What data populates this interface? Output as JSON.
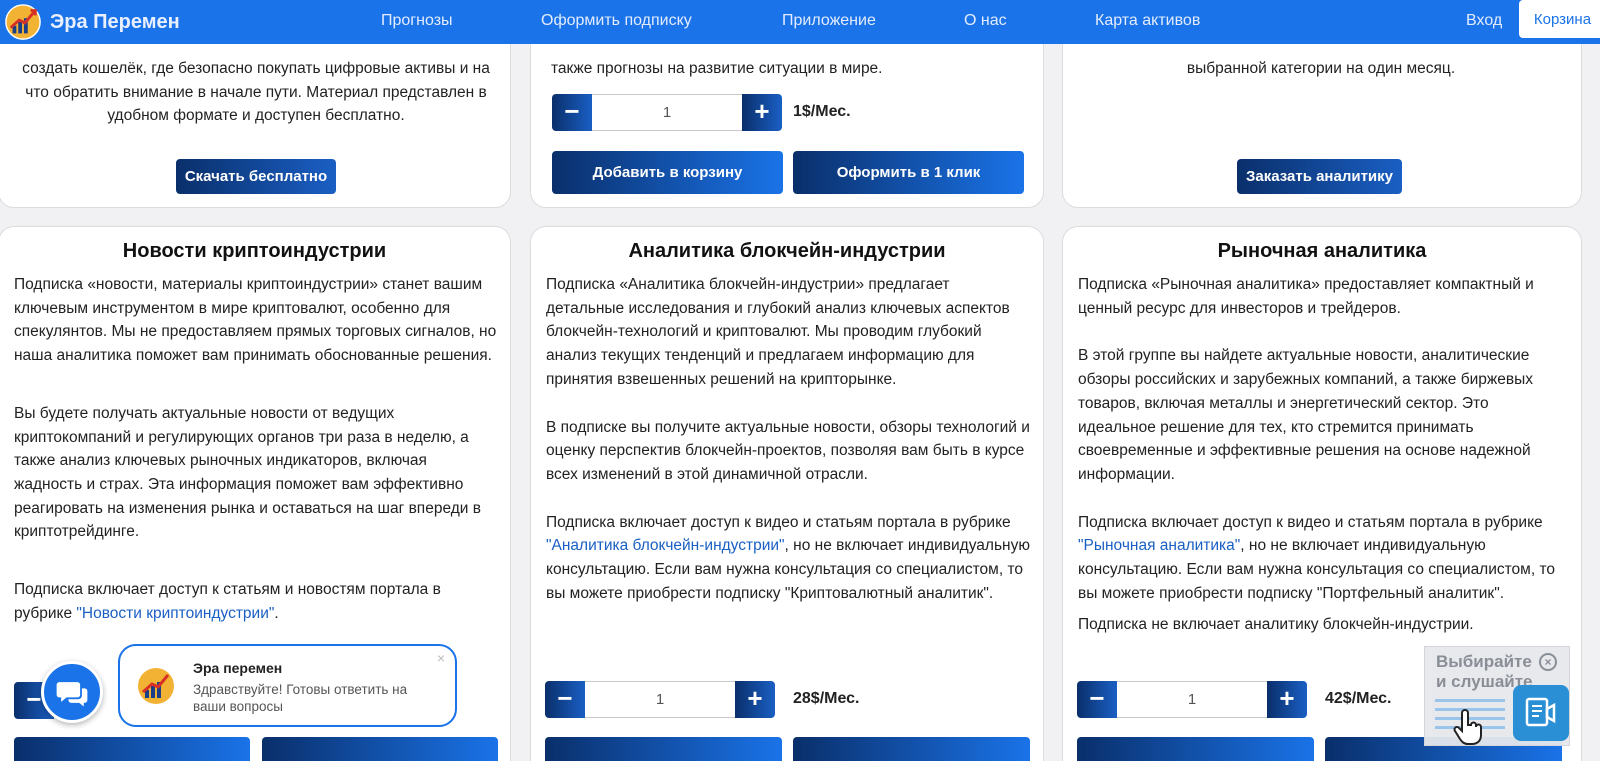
{
  "header": {
    "logo_text": "Эра Перемен",
    "nav": [
      "Прогнозы",
      "Оформить подписку",
      "Приложение",
      "О нас",
      "Карта активов"
    ],
    "login": "Вход",
    "cart": "Корзина"
  },
  "top_cards": {
    "left": {
      "text": "создать кошелёк, где безопасно покупать цифровые активы и на что обратить внимание в начале пути. Материал представлен в удобном формате и доступен бесплатно.",
      "button": "Скачать бесплатно"
    },
    "middle": {
      "text": "также прогнозы на развитие ситуации в мире.",
      "quantity": "1",
      "price": "1$/Мес.",
      "add_to_cart": "Добавить в корзину",
      "one_click": "Оформить в 1 клик"
    },
    "right": {
      "text": "выбранной категории на один месяц.",
      "button": "Заказать аналитику"
    }
  },
  "cards": [
    {
      "title": "Новости криптоиндустрии",
      "p1": "Подписка «новости, материалы криптоиндустрии» станет вашим ключевым инструментом в мире криптовалют, особенно для спекулянтов. Мы не предоставляем прямых торговых сигналов, но наша аналитика поможет вам принимать обоснованные решения.",
      "p2": "Вы будете получать актуальные новости от ведущих криптокомпаний и регулирующих органов три раза в неделю, а также анализ ключевых рыночных индикаторов, включая жадность и страх. Эта информация поможет вам эффективно реагировать на изменения рынка и оставаться на шаг впереди в криптотрейдинге.",
      "p3_before": "Подписка включает доступ к статьям и новостям портала в рубрике ",
      "p3_link": "\"Новости криптоиндустрии\"",
      "p3_after": "."
    },
    {
      "title": "Аналитика блокчейн-индустрии",
      "p1": "Подписка «Аналитика блокчейн-индустрии» предлагает детальные исследования и глубокий анализ ключевых аспектов блокчейн-технологий и криптовалют. Мы проводим глубокий анализ текущих тенденций и предлагаем информацию для принятия взвешенных решений на крипторынке.",
      "p2": "В подписке вы получите актуальные новости, обзоры технологий и оценку перспектив блокчейн-проектов, позволяя вам быть в курсе всех изменений в этой динамичной отрасли.",
      "p3_before": "Подписка включает доступ к видео и статьям портала в рубрике ",
      "p3_link": "\"Аналитика блокчейн-индустрии\"",
      "p3_after": ", но не включает индивидуальную консультацию. Если вам нужна консультация со специалистом, то вы можете приобрести подписку \"Криптовалютный аналитик\".",
      "quantity": "1",
      "price": "28$/Мес."
    },
    {
      "title": "Рыночная аналитика",
      "p1": "Подписка «Рыночная аналитика» предоставляет компактный и ценный ресурс для инвесторов и трейдеров.",
      "p2": "В этой группе вы найдете актуальные новости, аналитические обзоры российских и зарубежных компаний, а также биржевых товаров, включая металлы и энергетический сектор. Это идеальное решение для тех, кто стремится принимать своевременные и эффективные решения на основе надежной информации.",
      "p3_before": "Подписка включает доступ к видео и статьям портала в рубрике ",
      "p3_link": "\"Рыночная аналитика\"",
      "p3_after": ", но не включает индивидуальную консультацию. Если вам нужна консультация со специалистом, то вы можете приобрести подписку \"Портфельный аналитик\".",
      "p4": "Подписка не включает аналитику блокчейн-индустрии.",
      "quantity": "1",
      "price": "42$/Мес."
    }
  ],
  "chat": {
    "name": "Эра перемен",
    "message": "Здравствуйте! Готовы ответить на ваши вопросы",
    "close": "×"
  },
  "voice": {
    "text": "Выбирайте и слушайте",
    "close": "×"
  },
  "icons": {
    "logo": "chart-growth-icon",
    "chat": "chat-bubbles-icon",
    "voice": "listen-document-icon",
    "pointer": "hand-pointer-icon"
  },
  "colors": {
    "header": "#1a73e8",
    "button_dark": "#0a2f6b",
    "button_light": "#1a5fc4",
    "link": "#1a5fc4"
  }
}
